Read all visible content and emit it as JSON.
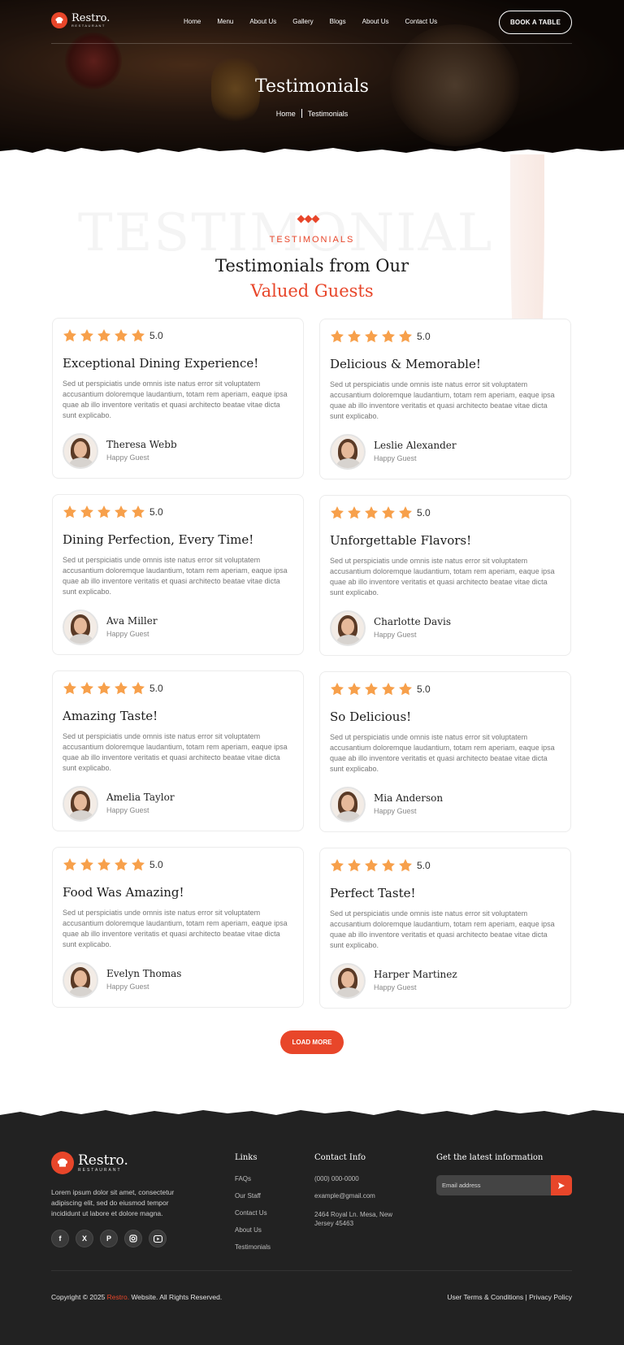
{
  "brand": {
    "name": "Restro.",
    "sub": "RESTAURANT"
  },
  "nav": {
    "items": [
      "Home",
      "Menu",
      "About Us",
      "Gallery",
      "Blogs",
      "About Us",
      "Contact Us"
    ],
    "cta": "BOOK A TABLE"
  },
  "hero": {
    "title": "Testimonials",
    "breadcrumb": [
      "Home",
      "Testimonials"
    ]
  },
  "section": {
    "bg_word": "TESTIMONIAL",
    "eyebrow": "TESTIMONIALS",
    "title_line1": "Testimonials from Our",
    "title_line2": "Valued Guests"
  },
  "testimonials": [
    {
      "rating": "5.0",
      "title": "Exceptional Dining Experience!",
      "text": "Sed ut perspiciatis unde omnis iste natus error sit voluptatem accusantium doloremque laudantium, totam rem aperiam, eaque ipsa quae ab illo inventore veritatis et quasi architecto beatae vitae dicta sunt explicabo.",
      "name": "Theresa Webb",
      "role": "Happy Guest"
    },
    {
      "rating": "5.0",
      "title": "Delicious & Memorable!",
      "text": "Sed ut perspiciatis unde omnis iste natus error sit voluptatem accusantium doloremque laudantium, totam rem aperiam, eaque ipsa quae ab illo inventore veritatis et quasi architecto beatae vitae dicta sunt explicabo.",
      "name": "Leslie Alexander",
      "role": "Happy Guest"
    },
    {
      "rating": "5.0",
      "title": "Dining Perfection, Every Time!",
      "text": "Sed ut perspiciatis unde omnis iste natus error sit voluptatem accusantium doloremque laudantium, totam rem aperiam, eaque ipsa quae ab illo inventore veritatis et quasi architecto beatae vitae dicta sunt explicabo.",
      "name": "Ava Miller",
      "role": "Happy Guest"
    },
    {
      "rating": "5.0",
      "title": "Unforgettable Flavors!",
      "text": "Sed ut perspiciatis unde omnis iste natus error sit voluptatem accusantium doloremque laudantium, totam rem aperiam, eaque ipsa quae ab illo inventore veritatis et quasi architecto beatae vitae dicta sunt explicabo.",
      "name": "Charlotte Davis",
      "role": "Happy Guest"
    },
    {
      "rating": "5.0",
      "title": "Amazing Taste!",
      "text": "Sed ut perspiciatis unde omnis iste natus error sit voluptatem accusantium doloremque laudantium, totam rem aperiam, eaque ipsa quae ab illo inventore veritatis et quasi architecto beatae vitae dicta sunt explicabo.",
      "name": "Amelia Taylor",
      "role": "Happy Guest"
    },
    {
      "rating": "5.0",
      "title": "So Delicious!",
      "text": "Sed ut perspiciatis unde omnis iste natus error sit voluptatem accusantium doloremque laudantium, totam rem aperiam, eaque ipsa quae ab illo inventore veritatis et quasi architecto beatae vitae dicta sunt explicabo.",
      "name": "Mia Anderson",
      "role": "Happy Guest"
    },
    {
      "rating": "5.0",
      "title": "Food Was Amazing!",
      "text": "Sed ut perspiciatis unde omnis iste natus error sit voluptatem accusantium doloremque laudantium, totam rem aperiam, eaque ipsa quae ab illo inventore veritatis et quasi architecto beatae vitae dicta sunt explicabo.",
      "name": "Evelyn Thomas",
      "role": "Happy Guest"
    },
    {
      "rating": "5.0",
      "title": "Perfect Taste!",
      "text": "Sed ut perspiciatis unde omnis iste natus error sit voluptatem accusantium doloremque laudantium, totam rem aperiam, eaque ipsa quae ab illo inventore veritatis et quasi architecto beatae vitae dicta sunt explicabo.",
      "name": "Harper Martinez",
      "role": "Happy Guest"
    }
  ],
  "load_more": "LOAD MORE",
  "footer": {
    "about": "Lorem ipsum dolor sit amet, consectetur adipiscing elit, sed do eiusmod tempor incididunt ut labore et dolore magna.",
    "socials": [
      "facebook-icon",
      "x-icon",
      "pinterest-icon",
      "instagram-icon",
      "youtube-icon"
    ],
    "links_heading": "Links",
    "links": [
      "FAQs",
      "Our Staff",
      "Contact Us",
      "About Us",
      "Testimonials"
    ],
    "contact_heading": "Contact Info",
    "phone": "(000) 000-0000",
    "email": "example@gmail.com",
    "address": "2464 Royal Ln. Mesa, New Jersey 45463",
    "newsletter_heading": "Get the latest information",
    "email_placeholder": "Email address",
    "copyright_pre": "Copyright © 2025",
    "copyright_brand": "Restro.",
    "copyright_post": "Website. All Rights Reserved.",
    "legal": "User Terms & Conditions | Privacy Policy"
  },
  "colors": {
    "accent": "#e8462a",
    "star": "#f7a04b",
    "footer_bg": "#222222"
  }
}
